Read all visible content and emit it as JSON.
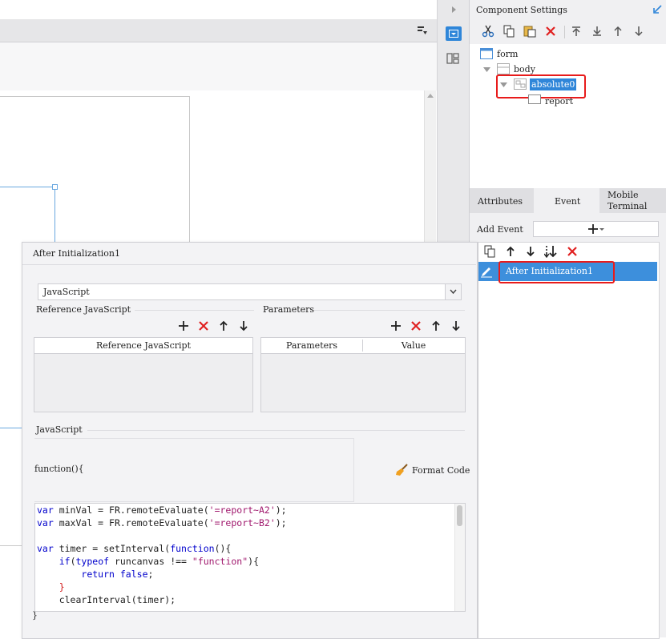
{
  "right_panel": {
    "title": "Component Settings",
    "tree": {
      "form": "form",
      "body": "body",
      "absolute": "absolute0",
      "report": "report"
    },
    "tabs": [
      "Attributes",
      "Event",
      "Mobile Terminal"
    ],
    "add_event_label": "Add Event",
    "events": [
      "After Initialization1"
    ]
  },
  "dialog": {
    "title": "After Initialization1",
    "type_select": "JavaScript",
    "ref_js_section": "Reference JavaScript",
    "ref_js_column": "Reference JavaScript",
    "params_section": "Parameters",
    "params_columns": [
      "Parameters",
      "Value"
    ],
    "js_section": "JavaScript",
    "function_header": "function(){",
    "format_code": "Format Code",
    "closing_brace": "}"
  },
  "code": {
    "line1": [
      "var",
      " minVal = FR.remoteEvaluate(",
      "'=report~A2'",
      ");"
    ],
    "line2": [
      "var",
      " maxVal = FR.remoteEvaluate(",
      "'=report~B2'",
      ");"
    ],
    "line4": [
      "var",
      " timer = setInterval(",
      "function",
      "(){"
    ],
    "line5": [
      "    ",
      "if",
      "(",
      "typeof",
      " runcanvas !== ",
      "\"function\"",
      "){"
    ],
    "line6": [
      "        ",
      "return",
      " ",
      "false",
      ";"
    ],
    "line7": [
      "    }"
    ],
    "line8": [
      "    clearInterval(timer);"
    ]
  }
}
